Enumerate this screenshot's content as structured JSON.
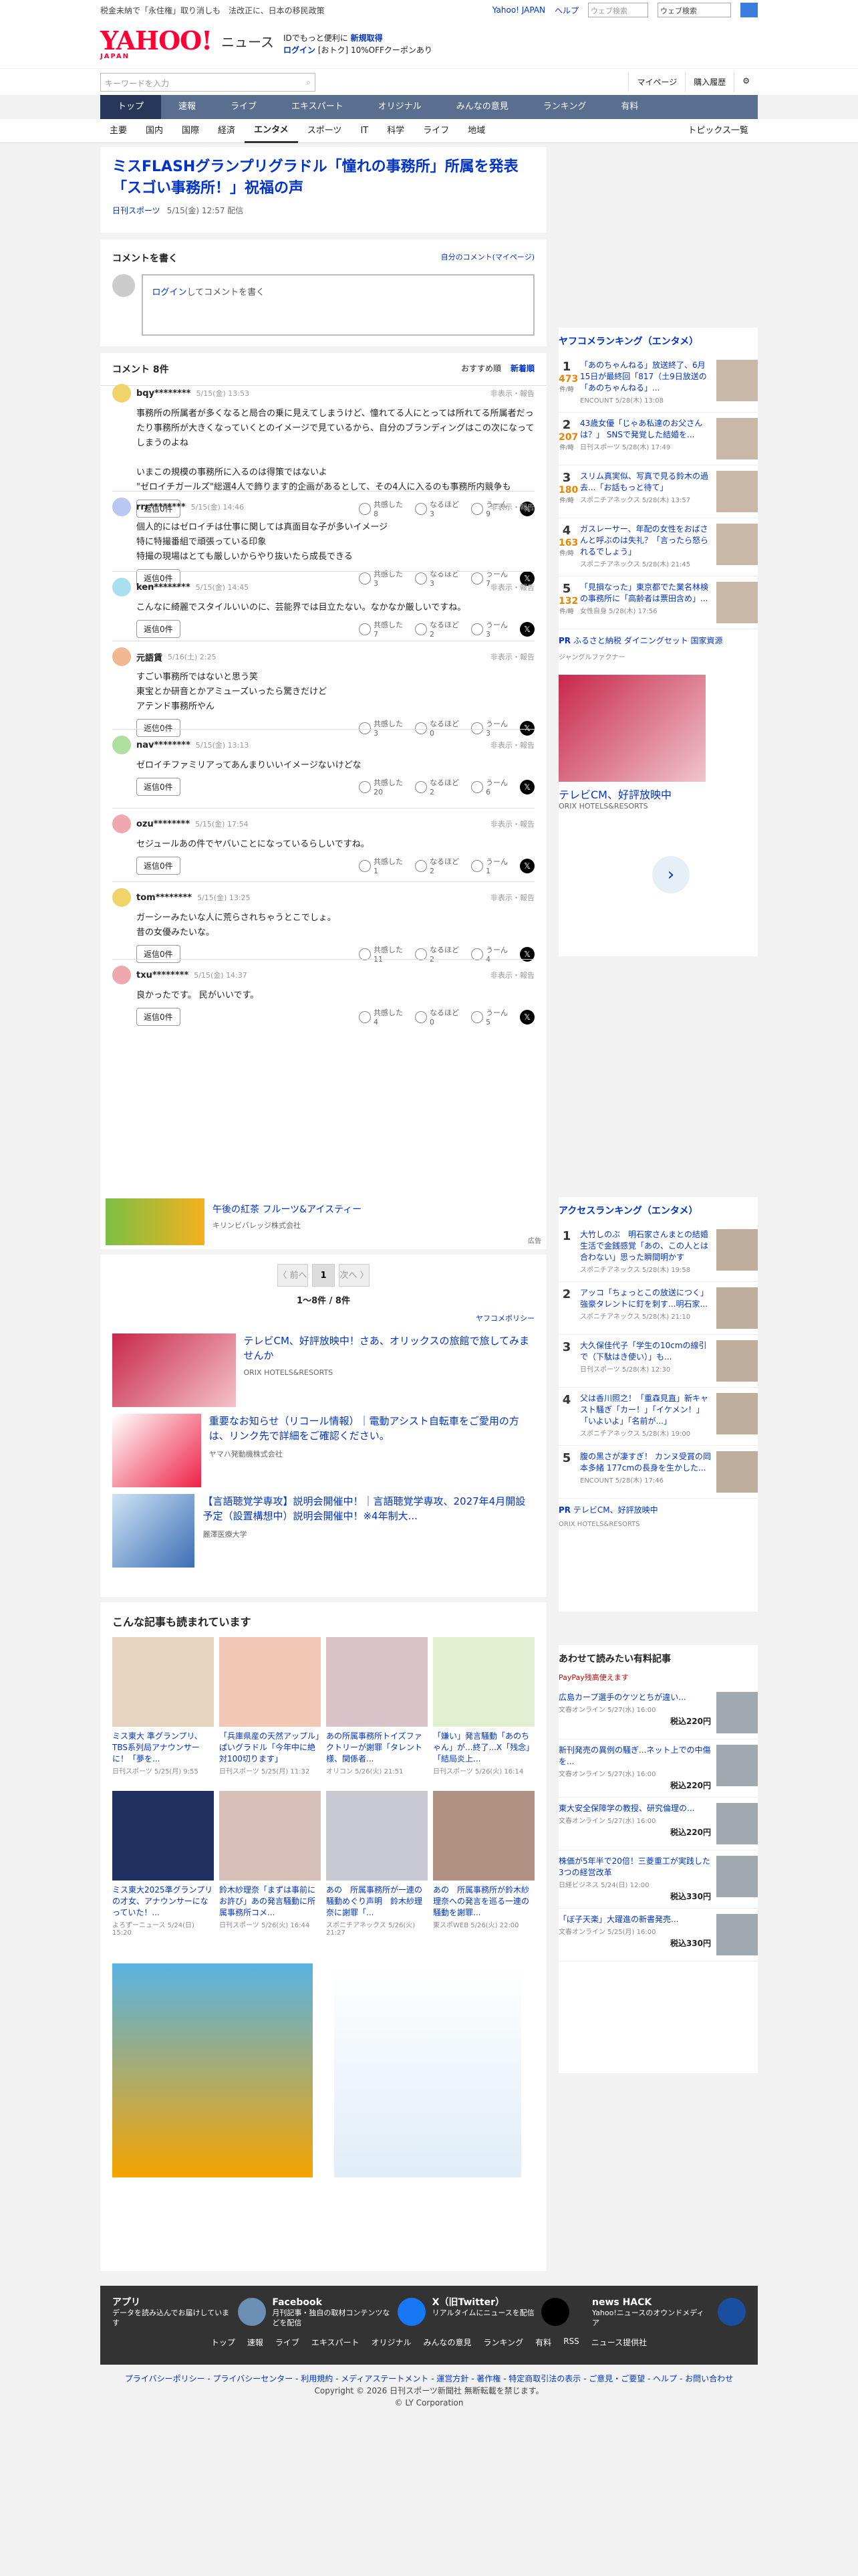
{
  "topbar": {
    "left": "税金未納で「永住権」取り消しも　法改正に、日本の移民政策",
    "yj": "Yahoo! JAPAN",
    "help": "ヘルプ",
    "search_placeholder": "ウェブ検索",
    "select": "",
    "sel_label": "ウェブ検索"
  },
  "header": {
    "logo": "YAHOO!",
    "logo_sub": "JAPAN",
    "site": "ニュース",
    "info1": "IDでもっと便利に",
    "info1b": "新規取得",
    "info2": "ログイン",
    "info2b": "[おトク] 10%OFFクーポンあり"
  },
  "search": {
    "placeholder": "キーワードを入力",
    "mypage": "マイページ",
    "purchase": "購入履歴"
  },
  "nav1": [
    "トップ",
    "速報",
    "ライブ",
    "エキスパート",
    "オリジナル",
    "みんなの意見",
    "ランキング",
    "有料"
  ],
  "nav2": [
    "主要",
    "国内",
    "国際",
    "経済",
    "エンタメ",
    "スポーツ",
    "IT",
    "科学",
    "ライフ",
    "地域"
  ],
  "nav2_topics": "トピックス一覧",
  "article": {
    "title": "ミスFLASHグランプリグラドル「憧れの事務所」所属を発表「スゴい事務所！」祝福の声",
    "source": "日刊スポーツ",
    "date": "5/15(金) 12:57 配信"
  },
  "comment_write": {
    "title": "コメントを書く",
    "mine": "自分のコメント(マイページ)",
    "placeholder_link": "ログイン",
    "placeholder": "してコメントを書く"
  },
  "comments_header": {
    "title": "コメント 8件",
    "sort_rec": "おすすめ順",
    "sort_new": "新着順"
  },
  "comments": [
    {
      "name": "bqy********",
      "date": "5/15(金) 13:53",
      "body": "事務所の所属者が多くなると局合の乗に見えてしまうけど、憧れてる人にとっては所れてる所属者だったり事務所が大きくなっていくとのイメージで見ているから、自分のブランディングはこの次になってしまうのよね\n\nいまこの規模の事務所に入るのは得策ではないよ\n\"ゼロイチガールズ\"総選4人で飾ります的企画があるとして、その4人に入るのも事務所内競争も",
      "reply": "返信0件",
      "r1": "8",
      "r2": "3",
      "r3": "9"
    },
    {
      "name": "rrr********",
      "date": "5/15(金) 14:46",
      "body": "個人的にはゼロイチは仕事に関しては真面目な子が多いイメージ\n特に特撮番組で頑張っている印象\n特撮の現場はとても厳しいからやり抜いたら成長できる",
      "reply": "返信0件",
      "r1": "3",
      "r2": "3",
      "r3": "7"
    },
    {
      "name": "ken********",
      "date": "5/15(金) 14:45",
      "body": "こんなに綺麗でスタイルいいのに、芸能界では目立たない。なかなか厳しいですね。",
      "reply": "返信0件",
      "r1": "7",
      "r2": "2",
      "r3": "3"
    },
    {
      "name": "元語賃",
      "date": "5/16(土) 2:25",
      "body": "すごい事務所ではないと思う笑\n東宝とか研音とかアミューズいったら驚きだけど\nアテンド事務所やん",
      "reply": "返信0件",
      "r1": "3",
      "r2": "0",
      "r3": "3"
    },
    {
      "name": "nav********",
      "date": "5/15(金) 13:13",
      "body": "ゼロイチファミリアってあんまりいいイメージないけどな",
      "reply": "返信0件",
      "r1": "20",
      "r2": "2",
      "r3": "6"
    },
    {
      "name": "ozu********",
      "date": "5/15(金) 17:54",
      "body": "セジュールあの件でヤバいことになっているらしいですね。",
      "reply": "返信0件",
      "r1": "1",
      "r2": "2",
      "r3": "1"
    },
    {
      "name": "tom********",
      "date": "5/15(金) 13:25",
      "body": "ガーシーみたいな人に荒らされちゃうとこでしょ。\n昔の女優みたいな。",
      "reply": "返信0件",
      "r1": "11",
      "r2": "2",
      "r3": "4"
    },
    {
      "name": "txu********",
      "date": "5/15(金) 14:37",
      "body": "良かったです。 民がいいです。",
      "reply": "返信0件",
      "r1": "4",
      "r2": "0",
      "r3": "5"
    }
  ],
  "react_labels": {
    "r1": "共感した",
    "r2": "なるほど",
    "r3": "うーん"
  },
  "report": "非表示・報告",
  "pr_banner": {
    "title": "午後の紅茶 フルーツ&アイスティー",
    "sub": "キリンビバレッジ株式会社",
    "ad": "広告"
  },
  "pager": {
    "prev": "〈 前へ",
    "cur": "1",
    "next": "次へ 〉",
    "count": "1〜8件 / 8件",
    "policy": "ヤフコメポリシー"
  },
  "ads": [
    {
      "title": "テレビCM、好評放映中！さあ、オリックスの旅館で旅してみませんか",
      "sub": "ORIX HOTELS&RESORTS"
    },
    {
      "title": "重要なお知らせ（リコール情報）｜電動アシスト自転車をご愛用の方は、リンク先で詳細をご確認ください。",
      "sub": "ヤマハ発動機株式会社"
    },
    {
      "title": "【言語聴覚学専攻】説明会開催中！｜言語聴覚学専攻、2027年4月開設予定（設置構想中）説明会開催中！※4年制大...",
      "sub": "麗澤医療大学"
    }
  ],
  "rec": {
    "title": "こんな記事も読まれています",
    "items": [
      {
        "t": "ミス東大 準グランプリ、TBS系列局アナウンサーに！「夢を...",
        "s": "日刊スポーツ 5/25(月) 9:55"
      },
      {
        "t": "「兵庫県産の天然アップル」ぱいグラドル「今年中に絶対100切ります」",
        "s": "日刊スポーツ 5/25(月) 11:32"
      },
      {
        "t": "あの所属事務所トイズファクトリーが謝罪「タレント様、関係者...",
        "s": "オリコン 5/26(火) 21:51"
      },
      {
        "t": "「嫌い」発言騒動「あのちゃん」が...終了...X「残念」「結局炎上...",
        "s": "日刊スポーツ 5/26(火) 16:14"
      },
      {
        "t": "ミス東大2025準グランプリの才女、アナウンサーになっていた！...",
        "s": "よろずーニュース 5/24(日) 15:20"
      },
      {
        "t": "鈴木紗理奈「まずは事前にお許び」あの発言騒動に所属事務所コメ...",
        "s": "日刊スポーツ 5/26(火) 16:44"
      },
      {
        "t": "あの　所属事務所が一連の騒動めぐり声明　鈴木紗理奈に謝罪「...",
        "s": "スポニチアネックス 5/26(火) 21:27"
      },
      {
        "t": "あの　所属事務所が鈴木紗理奈への発言を巡る一連の騒動を謝罪...",
        "s": "東スポWEB 5/26(火) 22:00"
      }
    ]
  },
  "ranking": {
    "title": "ヤフコメランキング（エンタメ）",
    "items": [
      {
        "n": "1",
        "c": "473",
        "t": "「あのちゃんねる」放送終了、6月15日が最終回「817（土9日放送の「あのちゃんねる」...",
        "s": "ENCOUNT 5/28(木) 13:08"
      },
      {
        "n": "2",
        "c": "207",
        "t": "43歳女優「じゃあ私達のお父さんは？」 SNSで発覚した結婚を...",
        "s": "日刊スポーツ 5/28(木) 17:49"
      },
      {
        "n": "3",
        "c": "180",
        "t": "スリム真実似、写真で見る鈴木の過去...「お話もっと待て」",
        "s": "スポニチアネックス 5/28(木) 13:57"
      },
      {
        "n": "4",
        "c": "163",
        "t": "ガスレーサー、年配の女性をおばさんと呼ぶのは失礼？「言ったら怒られるでしょう」",
        "s": "スポニチアネックス 5/28(木) 21:45"
      },
      {
        "n": "5",
        "c": "132",
        "t": "「見損なった」東京都でた業名林検の事務所に「高齢者は票田含め」...",
        "s": "女性自身 5/28(木) 17:56"
      }
    ],
    "pr": "ふるさと納税 ダイニングセット 国家資源",
    "pr_sub": "ジャングルファクナー",
    "ad": "広告"
  },
  "side_ad": {
    "title": "テレビCM、好評放映中",
    "sub": "ORIX HOTELS&RESORTS"
  },
  "access": {
    "title": "アクセスランキング（エンタメ）",
    "items": [
      {
        "n": "1",
        "t": "大竹しのぶ　明石家さんまとの結婚生活で金銭感覚「あの、この人とは合わない」思った瞬間明かす",
        "s": "スポニチアネックス 5/28(木) 19:58"
      },
      {
        "n": "2",
        "t": "アッコ「ちょっとこの放送につく」強豪タレントに釘を刺す...明石家...",
        "s": "スポニチアネックス 5/28(木) 21:10"
      },
      {
        "n": "3",
        "t": "大久保佳代子「学生の10cmの線引で（下駄はき使い）」も...",
        "s": "日刊スポーツ 5/28(木) 12:30"
      },
      {
        "n": "4",
        "t": "父は香川照之！「重森見直」新キャスト騒ぎ「カー！」「イケメン！」「いよいよ」「名前が...」",
        "s": "スポニチアネックス 5/28(木) 19:00"
      },
      {
        "n": "5",
        "t": "腹の黒さが凄すぎ！ カンヌ受賞の岡本多緒 177cmの長身を生かした...",
        "s": "ENCOUNT 5/28(木) 17:46"
      }
    ],
    "pr": "テレビCM、好評放映中",
    "pr_sub": "ORIX HOTELS&RESORTS"
  },
  "paid": {
    "title": "あわせて読みたい有料記事",
    "pay": "PayPay残高使えます",
    "items": [
      {
        "t": "広島カープ選手のケツとちが違い...",
        "s": "文春オンライン 5/27(水) 16:00",
        "p": "税込220円"
      },
      {
        "t": "新刊発売の異例の騒ぎ...ネット上での中傷を...",
        "s": "文春オンライン 5/27(水) 16:00",
        "p": "税込220円"
      },
      {
        "t": "東大安全保障学の教授、研究倫理の...",
        "s": "文春オンライン 5/27(水) 16:00",
        "p": "税込220円"
      },
      {
        "t": "株価が5年半で20倍！三菱重工が実践した3つの経営改革",
        "s": "日経ビジネス 5/24(日) 12:00",
        "p": "税込330円"
      },
      {
        "t": "「ぼ子天楽」大躍進の新書発売...",
        "s": "文春オンライン 5/25(月) 16:00",
        "p": "税込330円"
      }
    ]
  },
  "footer": {
    "items": [
      {
        "t": "アプリ",
        "d": "データを読み込んでお届けしています"
      },
      {
        "t": "Facebook",
        "d": "月刊記事・独自の取材コンテンツなどを配信"
      },
      {
        "t": "X（旧Twitter）",
        "d": "リアルタイムにニュースを配信"
      },
      {
        "t": "news HACK",
        "d": "Yahoo!ニュースのオウンドメディア"
      }
    ],
    "links": [
      "トップ",
      "速報",
      "ライブ",
      "エキスパート",
      "オリジナル",
      "みんなの意見",
      "ランキング",
      "有料",
      "RSS",
      "ニュース提供社"
    ],
    "legal_links": "プライバシーポリシー - プライバシーセンター - 利用規約 - メディアステートメント - 運営方針 - 著作権 - 特定商取引法の表示 - ご意見・ご要望 - ヘルプ - お問い合わせ",
    "copy": "Copyright © 2026 日刊スポーツ新聞社 無断転載を禁じます。",
    "lycorp": "© LY Corporation"
  },
  "colors": {
    "link": "#0033cc",
    "nav": "#5a6e8f",
    "brand": "#ff0033"
  }
}
